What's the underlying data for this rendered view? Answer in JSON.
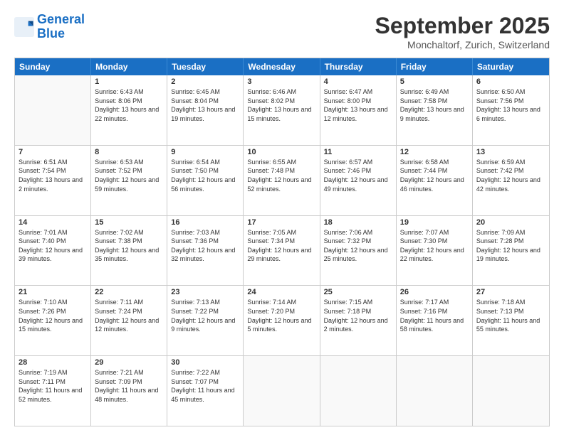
{
  "logo": {
    "line1": "General",
    "line2": "Blue"
  },
  "title": "September 2025",
  "location": "Monchaltorf, Zurich, Switzerland",
  "days_of_week": [
    "Sunday",
    "Monday",
    "Tuesday",
    "Wednesday",
    "Thursday",
    "Friday",
    "Saturday"
  ],
  "weeks": [
    [
      {
        "day": "",
        "empty": true
      },
      {
        "day": "1",
        "sunrise": "Sunrise: 6:43 AM",
        "sunset": "Sunset: 8:06 PM",
        "daylight": "Daylight: 13 hours and 22 minutes."
      },
      {
        "day": "2",
        "sunrise": "Sunrise: 6:45 AM",
        "sunset": "Sunset: 8:04 PM",
        "daylight": "Daylight: 13 hours and 19 minutes."
      },
      {
        "day": "3",
        "sunrise": "Sunrise: 6:46 AM",
        "sunset": "Sunset: 8:02 PM",
        "daylight": "Daylight: 13 hours and 15 minutes."
      },
      {
        "day": "4",
        "sunrise": "Sunrise: 6:47 AM",
        "sunset": "Sunset: 8:00 PM",
        "daylight": "Daylight: 13 hours and 12 minutes."
      },
      {
        "day": "5",
        "sunrise": "Sunrise: 6:49 AM",
        "sunset": "Sunset: 7:58 PM",
        "daylight": "Daylight: 13 hours and 9 minutes."
      },
      {
        "day": "6",
        "sunrise": "Sunrise: 6:50 AM",
        "sunset": "Sunset: 7:56 PM",
        "daylight": "Daylight: 13 hours and 6 minutes."
      }
    ],
    [
      {
        "day": "7",
        "sunrise": "Sunrise: 6:51 AM",
        "sunset": "Sunset: 7:54 PM",
        "daylight": "Daylight: 13 hours and 2 minutes."
      },
      {
        "day": "8",
        "sunrise": "Sunrise: 6:53 AM",
        "sunset": "Sunset: 7:52 PM",
        "daylight": "Daylight: 12 hours and 59 minutes."
      },
      {
        "day": "9",
        "sunrise": "Sunrise: 6:54 AM",
        "sunset": "Sunset: 7:50 PM",
        "daylight": "Daylight: 12 hours and 56 minutes."
      },
      {
        "day": "10",
        "sunrise": "Sunrise: 6:55 AM",
        "sunset": "Sunset: 7:48 PM",
        "daylight": "Daylight: 12 hours and 52 minutes."
      },
      {
        "day": "11",
        "sunrise": "Sunrise: 6:57 AM",
        "sunset": "Sunset: 7:46 PM",
        "daylight": "Daylight: 12 hours and 49 minutes."
      },
      {
        "day": "12",
        "sunrise": "Sunrise: 6:58 AM",
        "sunset": "Sunset: 7:44 PM",
        "daylight": "Daylight: 12 hours and 46 minutes."
      },
      {
        "day": "13",
        "sunrise": "Sunrise: 6:59 AM",
        "sunset": "Sunset: 7:42 PM",
        "daylight": "Daylight: 12 hours and 42 minutes."
      }
    ],
    [
      {
        "day": "14",
        "sunrise": "Sunrise: 7:01 AM",
        "sunset": "Sunset: 7:40 PM",
        "daylight": "Daylight: 12 hours and 39 minutes."
      },
      {
        "day": "15",
        "sunrise": "Sunrise: 7:02 AM",
        "sunset": "Sunset: 7:38 PM",
        "daylight": "Daylight: 12 hours and 35 minutes."
      },
      {
        "day": "16",
        "sunrise": "Sunrise: 7:03 AM",
        "sunset": "Sunset: 7:36 PM",
        "daylight": "Daylight: 12 hours and 32 minutes."
      },
      {
        "day": "17",
        "sunrise": "Sunrise: 7:05 AM",
        "sunset": "Sunset: 7:34 PM",
        "daylight": "Daylight: 12 hours and 29 minutes."
      },
      {
        "day": "18",
        "sunrise": "Sunrise: 7:06 AM",
        "sunset": "Sunset: 7:32 PM",
        "daylight": "Daylight: 12 hours and 25 minutes."
      },
      {
        "day": "19",
        "sunrise": "Sunrise: 7:07 AM",
        "sunset": "Sunset: 7:30 PM",
        "daylight": "Daylight: 12 hours and 22 minutes."
      },
      {
        "day": "20",
        "sunrise": "Sunrise: 7:09 AM",
        "sunset": "Sunset: 7:28 PM",
        "daylight": "Daylight: 12 hours and 19 minutes."
      }
    ],
    [
      {
        "day": "21",
        "sunrise": "Sunrise: 7:10 AM",
        "sunset": "Sunset: 7:26 PM",
        "daylight": "Daylight: 12 hours and 15 minutes."
      },
      {
        "day": "22",
        "sunrise": "Sunrise: 7:11 AM",
        "sunset": "Sunset: 7:24 PM",
        "daylight": "Daylight: 12 hours and 12 minutes."
      },
      {
        "day": "23",
        "sunrise": "Sunrise: 7:13 AM",
        "sunset": "Sunset: 7:22 PM",
        "daylight": "Daylight: 12 hours and 9 minutes."
      },
      {
        "day": "24",
        "sunrise": "Sunrise: 7:14 AM",
        "sunset": "Sunset: 7:20 PM",
        "daylight": "Daylight: 12 hours and 5 minutes."
      },
      {
        "day": "25",
        "sunrise": "Sunrise: 7:15 AM",
        "sunset": "Sunset: 7:18 PM",
        "daylight": "Daylight: 12 hours and 2 minutes."
      },
      {
        "day": "26",
        "sunrise": "Sunrise: 7:17 AM",
        "sunset": "Sunset: 7:16 PM",
        "daylight": "Daylight: 11 hours and 58 minutes."
      },
      {
        "day": "27",
        "sunrise": "Sunrise: 7:18 AM",
        "sunset": "Sunset: 7:13 PM",
        "daylight": "Daylight: 11 hours and 55 minutes."
      }
    ],
    [
      {
        "day": "28",
        "sunrise": "Sunrise: 7:19 AM",
        "sunset": "Sunset: 7:11 PM",
        "daylight": "Daylight: 11 hours and 52 minutes."
      },
      {
        "day": "29",
        "sunrise": "Sunrise: 7:21 AM",
        "sunset": "Sunset: 7:09 PM",
        "daylight": "Daylight: 11 hours and 48 minutes."
      },
      {
        "day": "30",
        "sunrise": "Sunrise: 7:22 AM",
        "sunset": "Sunset: 7:07 PM",
        "daylight": "Daylight: 11 hours and 45 minutes."
      },
      {
        "day": "",
        "empty": true
      },
      {
        "day": "",
        "empty": true
      },
      {
        "day": "",
        "empty": true
      },
      {
        "day": "",
        "empty": true
      }
    ]
  ]
}
